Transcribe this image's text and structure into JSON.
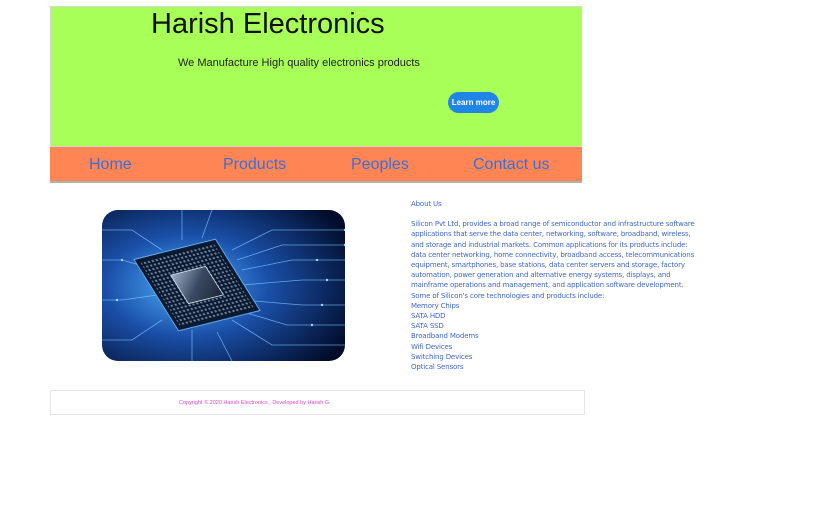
{
  "hero": {
    "title": "Harish Electronics",
    "tagline": "We Manufacture High quality electronics  products",
    "cta_label": "Learn more",
    "background": "#a8ff57",
    "cta_color": "#1f86e8"
  },
  "nav": {
    "background": "#ff8555",
    "items": [
      {
        "label": "Home"
      },
      {
        "label": "Products"
      },
      {
        "label": "Peoples"
      },
      {
        "label": "Contact us"
      }
    ]
  },
  "image": {
    "subject": "circuit-board-chip"
  },
  "about": {
    "title": "About Us",
    "description": "Silicon Pvt Ltd, provides a broad range of semiconductor and infrastructure software applications that serve the data center, networking, software, broadband, wireless, and storage and industrial markets. Common applications for its products include: data center networking, home connectivity, broadband access, telecommunications equipment, smartphones, base stations, data center servers and storage, factory automation, power generation and alternative energy systems, displays, and mainframe operations and management, and application software development.",
    "intro": "Some of Silicon's core technologies and products include:",
    "products": [
      "Memory Chips",
      "SATA HDD",
      "SATA SSD",
      "Broadband Modems",
      "Wifi Devices",
      "Switching Devices",
      "Optical Sensors"
    ]
  },
  "footer": {
    "copyright": "Copyright © 2020 Harish Electronics , Developed by Harish G"
  }
}
